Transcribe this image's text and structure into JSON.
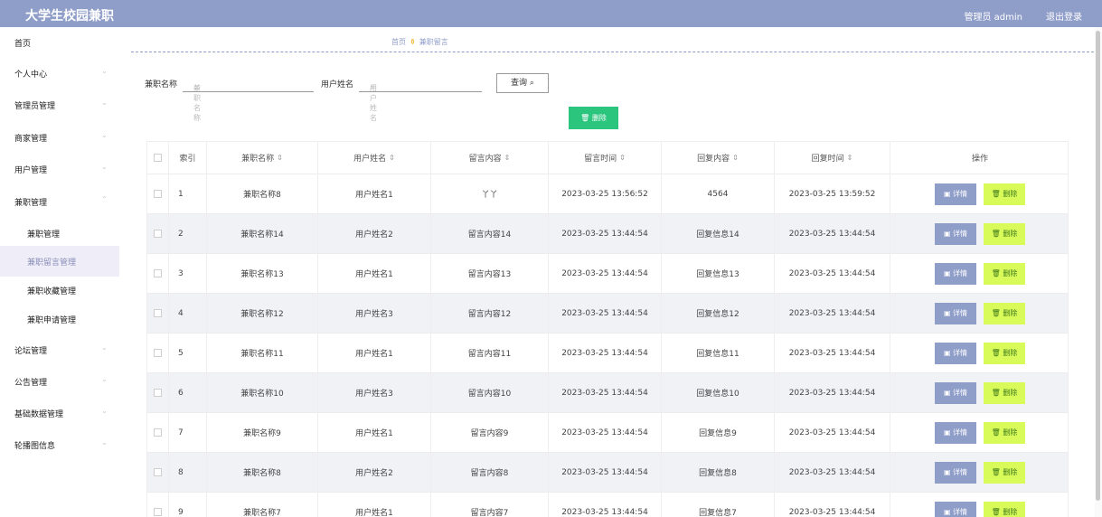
{
  "header": {
    "brand": "大学生校园兼职",
    "admin_label": "管理员 admin",
    "logout_label": "退出登录",
    "bar_color": "#8f9dc9"
  },
  "sidebar": {
    "items": [
      {
        "label": "首页",
        "chevron": ""
      },
      {
        "label": "个人中心",
        "chevron": "⌄"
      },
      {
        "label": "管理员管理",
        "chevron": "⌄"
      },
      {
        "label": "商家管理",
        "chevron": "⌄"
      },
      {
        "label": "用户管理",
        "chevron": "⌄"
      },
      {
        "label": "兼职管理",
        "chevron": "⌃"
      },
      {
        "label": "兼职管理",
        "chevron": ""
      },
      {
        "label": "兼职留言管理",
        "chevron": ""
      },
      {
        "label": "兼职收藏管理",
        "chevron": ""
      },
      {
        "label": "兼职申请管理",
        "chevron": ""
      },
      {
        "label": "论坛管理",
        "chevron": "⌄"
      },
      {
        "label": "公告管理",
        "chevron": "⌄"
      },
      {
        "label": "基础数据管理",
        "chevron": "⌄"
      },
      {
        "label": "轮播图信息",
        "chevron": "⌄"
      }
    ]
  },
  "breadcrumb": {
    "home": "首页",
    "separator_icon": "pin-icon",
    "separator": "⚱",
    "current": "兼职留言"
  },
  "search": {
    "job_name_label": "兼职名称",
    "job_name_placeholder": "兼职名称",
    "user_name_label": "用户姓名",
    "user_name_placeholder": "用户姓名",
    "query_button": "查询",
    "search_icon": "⌕"
  },
  "actions": {
    "delete_button": "删除",
    "delete_icon": "🗑",
    "accent_color": "#2cc57e"
  },
  "table": {
    "columns": [
      "",
      "索引",
      "兼职名称",
      "用户姓名",
      "留言内容",
      "留言时间",
      "回复内容",
      "回复时间",
      "操作"
    ],
    "sort_icon": "⇕",
    "detail_label": "详情",
    "delete_label": "删除",
    "rows": [
      {
        "index": "1",
        "job": "兼职名称8",
        "user": "用户姓名1",
        "msg": "丫丫",
        "msg_time": "2023-03-25 13:56:52",
        "reply": "4564",
        "reply_time": "2023-03-25 13:59:52"
      },
      {
        "index": "2",
        "job": "兼职名称14",
        "user": "用户姓名2",
        "msg": "留言内容14",
        "msg_time": "2023-03-25 13:44:54",
        "reply": "回复信息14",
        "reply_time": "2023-03-25 13:44:54"
      },
      {
        "index": "3",
        "job": "兼职名称13",
        "user": "用户姓名1",
        "msg": "留言内容13",
        "msg_time": "2023-03-25 13:44:54",
        "reply": "回复信息13",
        "reply_time": "2023-03-25 13:44:54"
      },
      {
        "index": "4",
        "job": "兼职名称12",
        "user": "用户姓名3",
        "msg": "留言内容12",
        "msg_time": "2023-03-25 13:44:54",
        "reply": "回复信息12",
        "reply_time": "2023-03-25 13:44:54"
      },
      {
        "index": "5",
        "job": "兼职名称11",
        "user": "用户姓名1",
        "msg": "留言内容11",
        "msg_time": "2023-03-25 13:44:54",
        "reply": "回复信息11",
        "reply_time": "2023-03-25 13:44:54"
      },
      {
        "index": "6",
        "job": "兼职名称10",
        "user": "用户姓名3",
        "msg": "留言内容10",
        "msg_time": "2023-03-25 13:44:54",
        "reply": "回复信息10",
        "reply_time": "2023-03-25 13:44:54"
      },
      {
        "index": "7",
        "job": "兼职名称9",
        "user": "用户姓名1",
        "msg": "留言内容9",
        "msg_time": "2023-03-25 13:44:54",
        "reply": "回复信息9",
        "reply_time": "2023-03-25 13:44:54"
      },
      {
        "index": "8",
        "job": "兼职名称8",
        "user": "用户姓名2",
        "msg": "留言内容8",
        "msg_time": "2023-03-25 13:44:54",
        "reply": "回复信息8",
        "reply_time": "2023-03-25 13:44:54"
      },
      {
        "index": "9",
        "job": "兼职名称7",
        "user": "用户姓名1",
        "msg": "留言内容7",
        "msg_time": "2023-03-25 13:44:54",
        "reply": "回复信息7",
        "reply_time": "2023-03-25 13:44:54"
      }
    ]
  }
}
